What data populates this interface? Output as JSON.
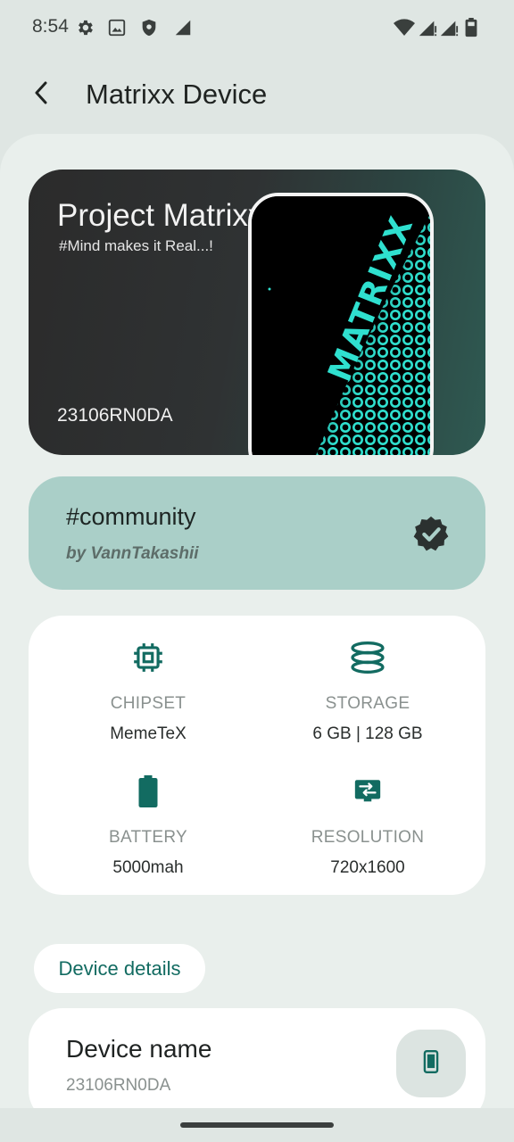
{
  "status_bar": {
    "time": "8:54",
    "left_icons": [
      "gear-icon",
      "image-icon",
      "shield-icon",
      "signal-partial-icon"
    ],
    "right_icons": [
      "wifi-icon",
      "cell-signal-icon",
      "cell-signal-icon",
      "battery-icon"
    ]
  },
  "app_bar": {
    "title": "Matrixx Device",
    "back_icon": "chevron-left-icon"
  },
  "hero": {
    "title": "Project Matrixx",
    "subtitle": "#Mind makes it Real...!",
    "model": "23106RN0DA",
    "phone_wordmark": "MATRIXX"
  },
  "community": {
    "title": "#community",
    "by": "by VannTakashii",
    "badge_icon": "verified-badge-icon"
  },
  "specs": [
    {
      "icon": "chip-icon",
      "label": "CHIPSET",
      "value": "MemeTeX"
    },
    {
      "icon": "storage-icon",
      "label": "STORAGE",
      "value": "6 GB | 128 GB"
    },
    {
      "icon": "battery-icon",
      "label": "BATTERY",
      "value": "5000mah"
    },
    {
      "icon": "resolution-icon",
      "label": "RESOLUTION",
      "value": "720x1600"
    }
  ],
  "device_details": {
    "pill_label": "Device details",
    "name_title": "Device name",
    "name_value": "23106RN0DA",
    "name_icon": "phone-icon"
  },
  "colors": {
    "accent": "#126b61",
    "community_bg": "#aacfc8",
    "sheet_bg": "#e9efec",
    "page_bg": "#dfe6e3"
  }
}
